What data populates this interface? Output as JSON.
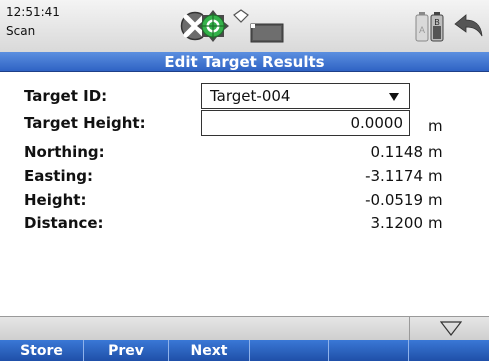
{
  "status": {
    "time": "12:51:41",
    "mode": "Scan",
    "icons": [
      "compass-icon",
      "target-icon",
      "diamond-icon",
      "screen-icon",
      "battery-icon",
      "back-arrow-icon"
    ]
  },
  "title": "Edit Target Results",
  "form": {
    "target_id": {
      "label": "Target ID:",
      "value": "Target-004"
    },
    "target_height": {
      "label": "Target Height:",
      "value": "0.0000",
      "unit": "m"
    },
    "northing": {
      "label": "Northing:",
      "value": "0.1148",
      "unit": "m"
    },
    "easting": {
      "label": "Easting:",
      "value": "-3.1174",
      "unit": "m"
    },
    "height": {
      "label": "Height:",
      "value": "-0.0519",
      "unit": "m"
    },
    "distance": {
      "label": "Distance:",
      "value": "3.1200",
      "unit": "m"
    }
  },
  "softkeys": [
    "Store",
    "Prev",
    "Next",
    "",
    "",
    ""
  ],
  "colors": {
    "titlebar": "#2f63c4",
    "softkeys": "#1f4fa8",
    "target_green": "#34b24a"
  }
}
